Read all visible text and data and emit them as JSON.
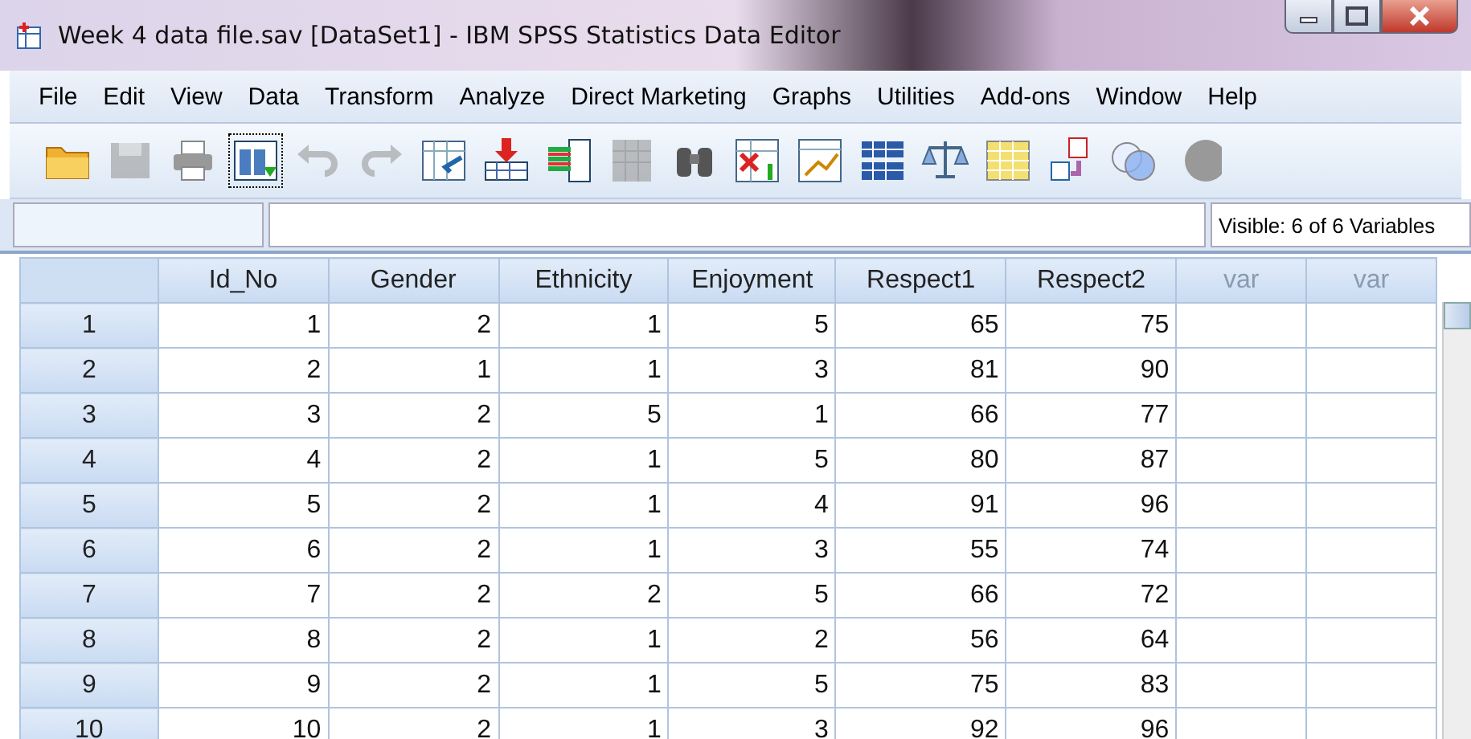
{
  "window": {
    "title": "Week 4 data file.sav [DataSet1] - IBM SPSS Statistics Data Editor"
  },
  "menu": [
    "File",
    "Edit",
    "View",
    "Data",
    "Transform",
    "Analyze",
    "Direct Marketing",
    "Graphs",
    "Utilities",
    "Add-ons",
    "Window",
    "Help"
  ],
  "toolbar": [
    {
      "disabled": false
    },
    {
      "disabled": true
    },
    {
      "disabled": false
    },
    {
      "disabled": false
    },
    {
      "disabled": true
    },
    {
      "disabled": true
    },
    {
      "disabled": false
    },
    {
      "disabled": false
    },
    {
      "disabled": false
    },
    {
      "disabled": true
    },
    {
      "disabled": false
    },
    {
      "disabled": false
    },
    {
      "disabled": false
    },
    {
      "disabled": false
    },
    {
      "disabled": false
    },
    {
      "disabled": false
    },
    {
      "disabled": false
    },
    {
      "disabled": false
    },
    {
      "disabled": false
    }
  ],
  "cell_editor": {
    "status": "Visible: 6 of 6 Variables"
  },
  "table": {
    "columns": [
      {
        "label": "Id_No",
        "kind": "variable"
      },
      {
        "label": "Gender",
        "kind": "variable"
      },
      {
        "label": "Ethnicity",
        "kind": "variable"
      },
      {
        "label": "Enjoyment",
        "kind": "variable"
      },
      {
        "label": "Respect1",
        "kind": "variable"
      },
      {
        "label": "Respect2",
        "kind": "variable"
      },
      {
        "label": "var",
        "kind": "empty"
      },
      {
        "label": "var",
        "kind": "empty"
      }
    ],
    "rows": [
      {
        "number": "1",
        "cells": [
          "1",
          "2",
          "1",
          "5",
          "65",
          "75"
        ]
      },
      {
        "number": "2",
        "cells": [
          "2",
          "1",
          "1",
          "3",
          "81",
          "90"
        ]
      },
      {
        "number": "3",
        "cells": [
          "3",
          "2",
          "5",
          "1",
          "66",
          "77"
        ]
      },
      {
        "number": "4",
        "cells": [
          "4",
          "2",
          "1",
          "5",
          "80",
          "87"
        ]
      },
      {
        "number": "5",
        "cells": [
          "5",
          "2",
          "1",
          "4",
          "91",
          "96"
        ]
      },
      {
        "number": "6",
        "cells": [
          "6",
          "2",
          "1",
          "3",
          "55",
          "74"
        ]
      },
      {
        "number": "7",
        "cells": [
          "7",
          "2",
          "2",
          "5",
          "66",
          "72"
        ]
      },
      {
        "number": "8",
        "cells": [
          "8",
          "2",
          "1",
          "2",
          "56",
          "64"
        ]
      },
      {
        "number": "9",
        "cells": [
          "9",
          "2",
          "1",
          "5",
          "75",
          "83"
        ]
      },
      {
        "number": "10",
        "cells": [
          "10",
          "2",
          "1",
          "3",
          "92",
          "96"
        ]
      }
    ]
  }
}
